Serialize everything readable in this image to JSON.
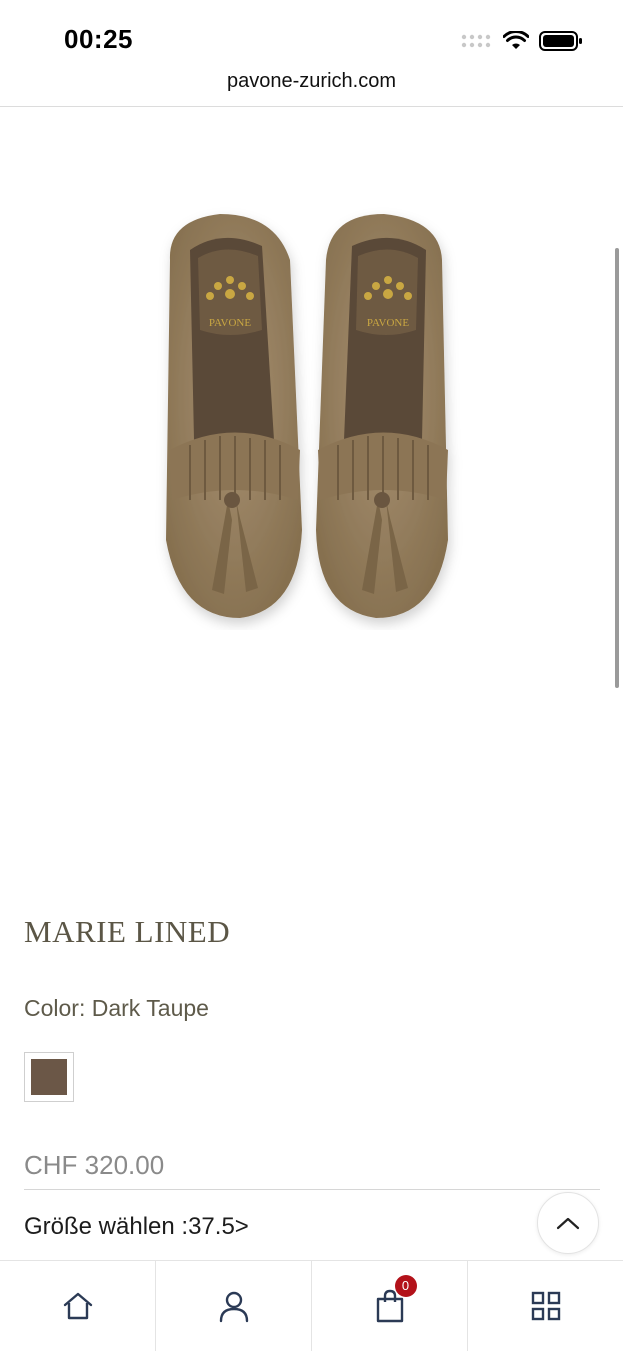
{
  "status_bar": {
    "time": "00:25",
    "icons": [
      "signal-dots-icon",
      "wifi-icon",
      "battery-icon"
    ]
  },
  "browser": {
    "url": "pavone-zurich.com"
  },
  "product": {
    "image_icon": "loafer-slippers-image",
    "brand_insole_text": "PAVONE",
    "title": "MARIE LINED",
    "color_line": "Color: Dark Taupe",
    "swatch_color": "#6b5747",
    "price": "CHF 320.00",
    "size_selector": "Größe wählen :37.5>"
  },
  "bottom_nav": {
    "items": [
      {
        "icon": "home-icon"
      },
      {
        "icon": "account-icon"
      },
      {
        "icon": "cart-icon",
        "badge": "0"
      },
      {
        "icon": "grid-menu-icon"
      }
    ]
  },
  "colors": {
    "title": "#5b5646",
    "badge": "#b3121a",
    "shoe": "#9c8667"
  }
}
